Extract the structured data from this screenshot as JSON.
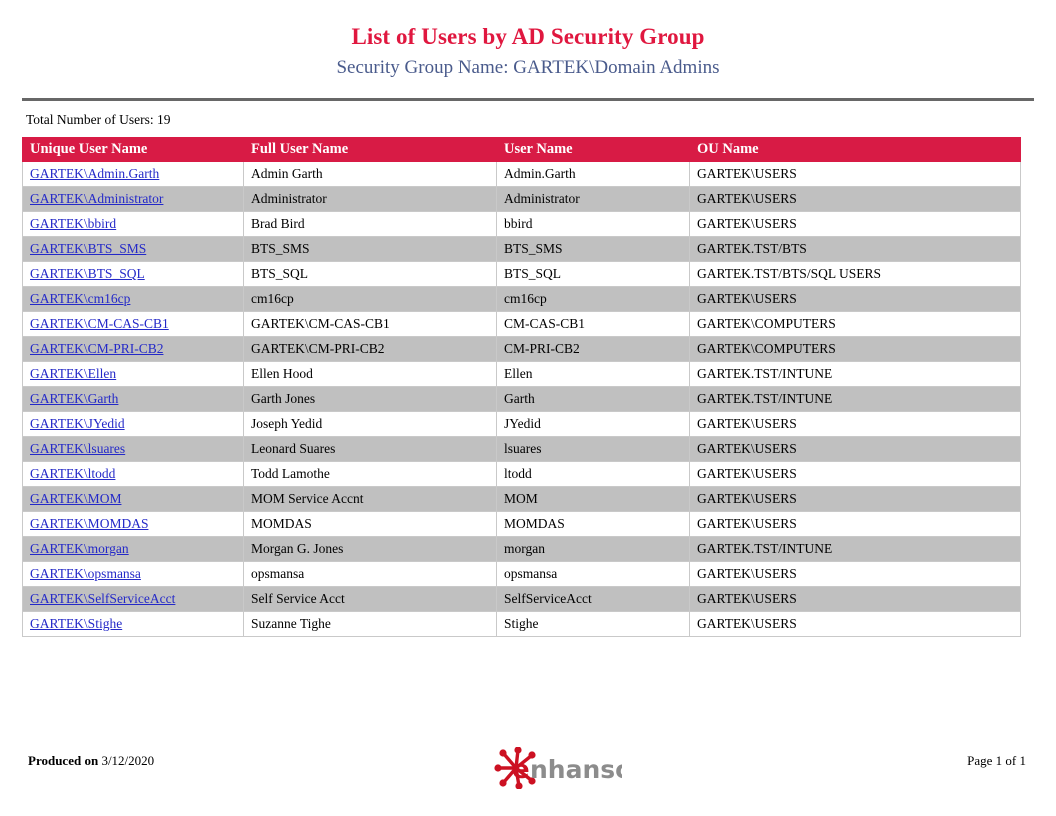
{
  "report": {
    "title": "List of Users by AD Security Group",
    "subtitle": "Security Group Name: GARTEK\\Domain Admins",
    "summary": "Total Number of Users: 19",
    "accent_color": "#d81b45",
    "subtitle_color": "#4a5b8c",
    "link_color": "#2429c8",
    "alt_row_color": "#c0c0c0"
  },
  "table": {
    "columns": [
      "Unique User Name",
      "Full User Name",
      "User Name",
      "OU Name"
    ],
    "rows": [
      {
        "unique_user_name": "GARTEK\\Admin.Garth",
        "full_user_name": "Admin Garth",
        "user_name": "Admin.Garth",
        "ou_name": "GARTEK\\USERS"
      },
      {
        "unique_user_name": "GARTEK\\Administrator",
        "full_user_name": "Administrator",
        "user_name": "Administrator",
        "ou_name": "GARTEK\\USERS"
      },
      {
        "unique_user_name": "GARTEK\\bbird",
        "full_user_name": "Brad Bird",
        "user_name": "bbird",
        "ou_name": "GARTEK\\USERS"
      },
      {
        "unique_user_name": "GARTEK\\BTS_SMS",
        "full_user_name": "BTS_SMS",
        "user_name": "BTS_SMS",
        "ou_name": "GARTEK.TST/BTS"
      },
      {
        "unique_user_name": "GARTEK\\BTS_SQL",
        "full_user_name": "BTS_SQL",
        "user_name": "BTS_SQL",
        "ou_name": "GARTEK.TST/BTS/SQL USERS"
      },
      {
        "unique_user_name": "GARTEK\\cm16cp",
        "full_user_name": "cm16cp",
        "user_name": "cm16cp",
        "ou_name": "GARTEK\\USERS"
      },
      {
        "unique_user_name": "GARTEK\\CM-CAS-CB1",
        "full_user_name": "GARTEK\\CM-CAS-CB1",
        "user_name": "CM-CAS-CB1",
        "ou_name": "GARTEK\\COMPUTERS"
      },
      {
        "unique_user_name": "GARTEK\\CM-PRI-CB2",
        "full_user_name": "GARTEK\\CM-PRI-CB2",
        "user_name": "CM-PRI-CB2",
        "ou_name": "GARTEK\\COMPUTERS"
      },
      {
        "unique_user_name": "GARTEK\\Ellen",
        "full_user_name": "Ellen Hood",
        "user_name": "Ellen",
        "ou_name": "GARTEK.TST/INTUNE"
      },
      {
        "unique_user_name": "GARTEK\\Garth",
        "full_user_name": "Garth Jones",
        "user_name": "Garth",
        "ou_name": "GARTEK.TST/INTUNE"
      },
      {
        "unique_user_name": "GARTEK\\JYedid",
        "full_user_name": "Joseph Yedid",
        "user_name": "JYedid",
        "ou_name": "GARTEK\\USERS"
      },
      {
        "unique_user_name": "GARTEK\\lsuares",
        "full_user_name": "Leonard Suares",
        "user_name": "lsuares",
        "ou_name": "GARTEK\\USERS"
      },
      {
        "unique_user_name": "GARTEK\\ltodd",
        "full_user_name": "Todd Lamothe",
        "user_name": "ltodd",
        "ou_name": "GARTEK\\USERS"
      },
      {
        "unique_user_name": "GARTEK\\MOM",
        "full_user_name": "MOM Service Accnt",
        "user_name": "MOM",
        "ou_name": "GARTEK\\USERS"
      },
      {
        "unique_user_name": "GARTEK\\MOMDAS",
        "full_user_name": "MOMDAS",
        "user_name": "MOMDAS",
        "ou_name": "GARTEK\\USERS"
      },
      {
        "unique_user_name": "GARTEK\\morgan",
        "full_user_name": "Morgan G. Jones",
        "user_name": "morgan",
        "ou_name": "GARTEK.TST/INTUNE"
      },
      {
        "unique_user_name": "GARTEK\\opsmansa",
        "full_user_name": "opsmansa",
        "user_name": "opsmansa",
        "ou_name": "GARTEK\\USERS"
      },
      {
        "unique_user_name": "GARTEK\\SelfServiceAcct",
        "full_user_name": "Self Service Acct",
        "user_name": "SelfServiceAcct",
        "ou_name": "GARTEK\\USERS"
      },
      {
        "unique_user_name": "GARTEK\\Stighe",
        "full_user_name": "Suzanne Tighe",
        "user_name": "Stighe",
        "ou_name": "GARTEK\\USERS"
      }
    ]
  },
  "footer": {
    "produced_label": "Produced on ",
    "produced_date": "3/12/2020",
    "page_info": "Page 1 of 1",
    "logo_text": "nhansoft",
    "logo_mark_color": "#cc1122",
    "logo_text_color": "#8c8c8c"
  }
}
